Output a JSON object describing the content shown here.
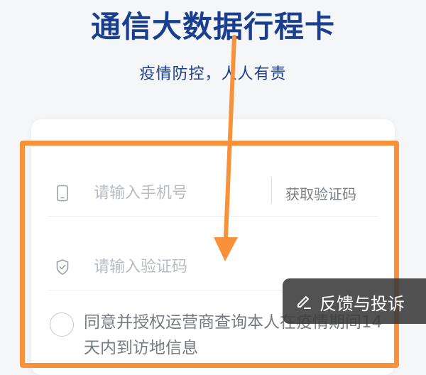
{
  "header": {
    "title": "通信大数据行程卡",
    "subtitle": "疫情防控，人人有责"
  },
  "form": {
    "phone_placeholder": "请输入手机号",
    "phone_icon": "mobile-phone-icon",
    "get_code_label": "获取验证码",
    "code_placeholder": "请输入验证码",
    "code_icon": "shield-check-icon",
    "agreement_text": "同意并授权运营商查询本人在疫情期间14天内到访地信息"
  },
  "feedback": {
    "label": "反馈与投诉",
    "icon": "pencil-icon"
  },
  "colors": {
    "brand": "#1b3f8f",
    "annotation": "#f7923a",
    "placeholder": "#b8bcc4"
  }
}
